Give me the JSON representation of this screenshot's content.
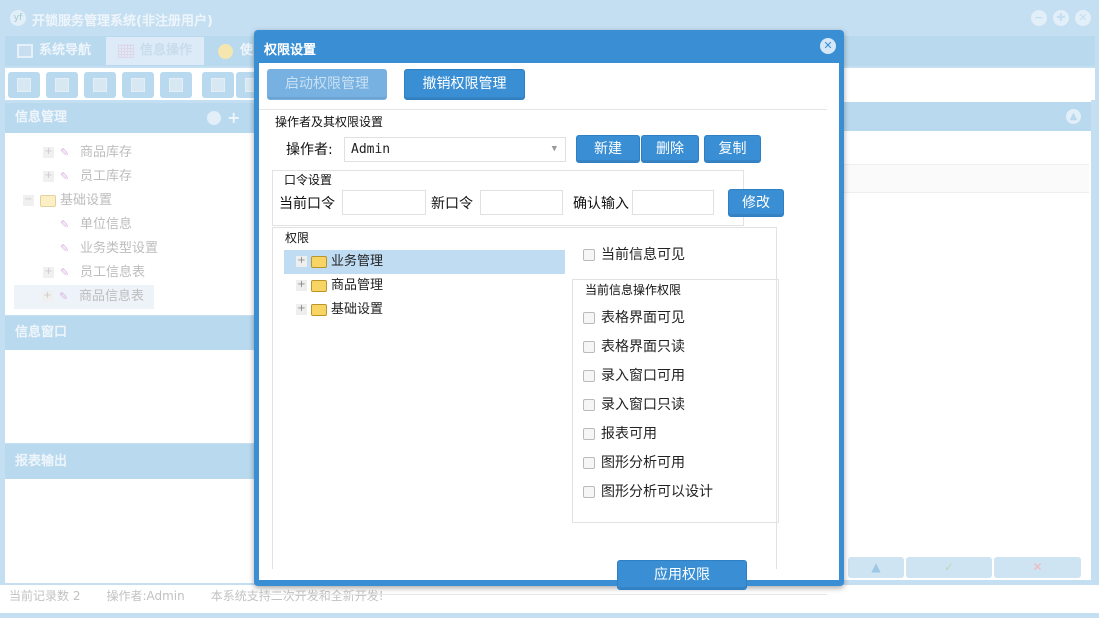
{
  "app": {
    "title": "开锁服务管理系统(非注册用户)",
    "logo": "yf"
  },
  "window_controls": [
    {
      "icon": "minimize-icon",
      "glyph": "−"
    },
    {
      "icon": "restore-icon",
      "glyph": "✚"
    },
    {
      "icon": "close-icon",
      "glyph": "✕"
    }
  ],
  "tabs": [
    {
      "label": "系统导航",
      "icon": "monitor-icon"
    },
    {
      "label": "信息操作",
      "icon": "grid-icon"
    },
    {
      "label": "使",
      "icon": "help-icon"
    }
  ],
  "sidebar": {
    "sections": [
      {
        "title": "信息管理"
      },
      {
        "title": "信息窗口"
      },
      {
        "title": "报表输出"
      }
    ],
    "tree": [
      {
        "label": "商品库存",
        "level": 2,
        "expander": "+"
      },
      {
        "label": "员工库存",
        "level": 2,
        "expander": "+"
      },
      {
        "label": "基础设置",
        "level": 1,
        "expander": "−",
        "folder": true
      },
      {
        "label": "单位信息",
        "level": 2,
        "expander": ""
      },
      {
        "label": "业务类型设置",
        "level": 2,
        "expander": ""
      },
      {
        "label": "员工信息表",
        "level": 2,
        "expander": "+"
      },
      {
        "label": "商品信息表",
        "level": 2,
        "expander": "+",
        "selected": true
      }
    ]
  },
  "status": {
    "record_count": "当前记录数 2",
    "operator": "操作者:Admin",
    "message": "本系统支持二次开发和全新开发!"
  },
  "right_buttons": [
    {
      "glyph": "▲",
      "color": "#9cc7e6"
    },
    {
      "glyph": "✓",
      "color": "#b6dcb6"
    },
    {
      "glyph": "✕",
      "color": "#f2b8b8"
    }
  ],
  "dialog": {
    "title": "权限设置",
    "enable_button": "启动权限管理",
    "revoke_button": "撤销权限管理",
    "operator_group": {
      "title": "操作者及其权限设置",
      "operator_label": "操作者:",
      "operator_value": "Admin",
      "new_button": "新建",
      "delete_button": "删除",
      "copy_button": "复制"
    },
    "password_group": {
      "title": "口令设置",
      "current_label": "当前口令",
      "current_value": "",
      "new_label": "新口令",
      "new_value": "",
      "confirm_label": "确认输入",
      "confirm_value": "",
      "modify_button": "修改"
    },
    "permission_group": {
      "title": "权限",
      "tree": [
        {
          "label": "业务管理",
          "selected": true
        },
        {
          "label": "商品管理"
        },
        {
          "label": "基础设置"
        }
      ],
      "visible_checkbox": {
        "label": "当前信息可见",
        "checked": false
      },
      "ops_title": "当前信息操作权限",
      "ops": [
        {
          "label": "表格界面可见",
          "checked": false
        },
        {
          "label": "表格界面只读",
          "checked": false
        },
        {
          "label": "录入窗口可用",
          "checked": false
        },
        {
          "label": "录入窗口只读",
          "checked": false
        },
        {
          "label": "报表可用",
          "checked": false
        },
        {
          "label": "图形分析可用",
          "checked": false
        },
        {
          "label": "图形分析可以设计",
          "checked": false
        }
      ],
      "apply_button": "应用权限"
    }
  }
}
